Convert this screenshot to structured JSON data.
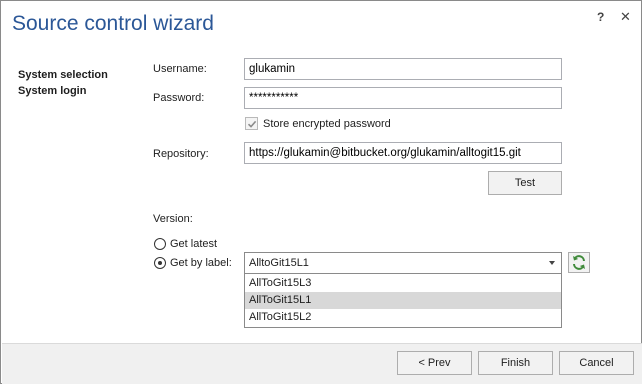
{
  "window": {
    "title": "Source control wizard",
    "help": "?",
    "close": "✕"
  },
  "nav": {
    "items": [
      "System selection",
      "System login"
    ]
  },
  "form": {
    "username_label": "Username:",
    "username_value": "glukamin",
    "password_label": "Password:",
    "password_value": "***********",
    "store_label": "Store encrypted password",
    "store_checked": true,
    "repository_label": "Repository:",
    "repository_value": "https://glukamin@bitbucket.org/glukamin/alltogit15.git",
    "test_label": "Test",
    "version_label": "Version:",
    "get_latest_label": "Get latest",
    "get_by_label_label": "Get by label:",
    "selected_label": "AlltoGit15L1",
    "options": [
      "AllToGit15L3",
      "AllToGit15L1",
      "AllToGit15L2"
    ],
    "highlighted_option": "AllToGit15L1"
  },
  "footer": {
    "prev_label": "< Prev",
    "finish_label": "Finish",
    "cancel_label": "Cancel"
  },
  "colors": {
    "title": "#2b5797",
    "refresh_icon": "#3f8a3a",
    "highlight": "#d8d8d8"
  }
}
